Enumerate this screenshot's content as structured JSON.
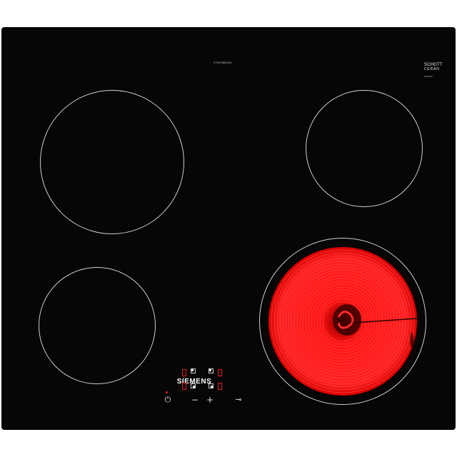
{
  "product": {
    "brand": "SIEMENS",
    "model_code": "ET61RBEA1E",
    "glass_brand": {
      "line1": "SCHOTT",
      "line2": "CERAN",
      "line3": "0000000"
    }
  },
  "zones": [
    {
      "name": "rear-left",
      "active": false
    },
    {
      "name": "rear-right",
      "active": false
    },
    {
      "name": "front-left",
      "active": false
    },
    {
      "name": "front-right",
      "active": true
    }
  ],
  "controls": {
    "power_symbol": "⏻",
    "minus_symbol": "−",
    "plus_symbol": "+",
    "lock_symbol": "⊸",
    "icons": [
      "power-icon",
      "minus-icon",
      "plus-icon",
      "key-lock-icon",
      "zone-selector-icon"
    ]
  },
  "colors": {
    "glass": "#060606",
    "zone_outline": "#cfcfcf",
    "heat": "#ff1a1a",
    "display": "#e02020"
  }
}
